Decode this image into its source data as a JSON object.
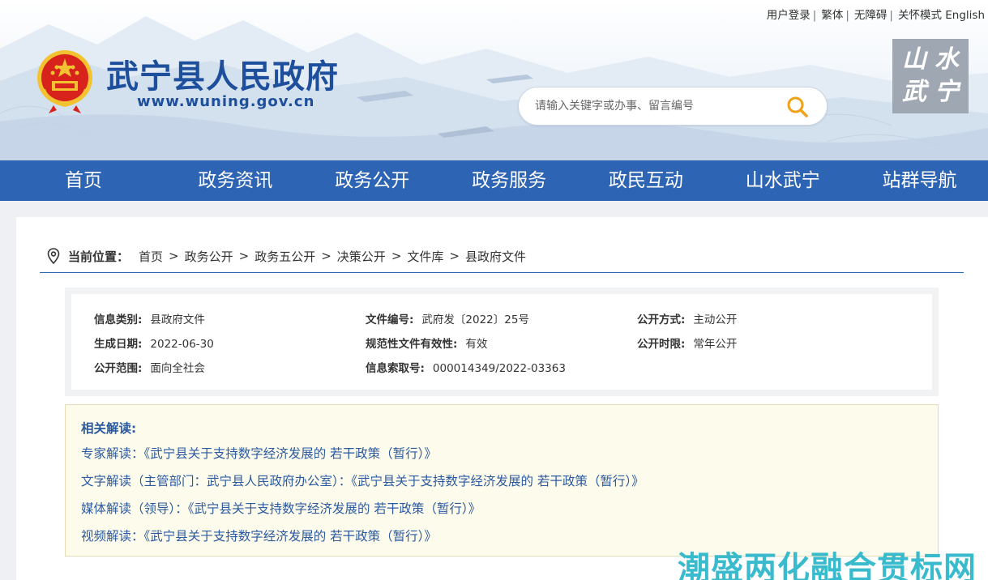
{
  "top_links": {
    "login": "用户登录",
    "traditional": "繁体",
    "accessibility": "无障碍",
    "care_mode": "关怀模式",
    "english": "English",
    "separator": "|"
  },
  "site": {
    "title": "武宁县人民政府",
    "url": "www.wuning.gov.cn",
    "seal_chars": [
      "山",
      "水",
      "武",
      "宁"
    ]
  },
  "search": {
    "placeholder": "请输入关键字或办事、留言编号",
    "value": ""
  },
  "nav": {
    "items": [
      "首页",
      "政务资讯",
      "政务公开",
      "政务服务",
      "政民互动",
      "山水武宁",
      "站群导航"
    ]
  },
  "breadcrumb": {
    "label": "当前位置：",
    "items": [
      "首页",
      "政务公开",
      "政务五公开",
      "决策公开",
      "文件库",
      "县政府文件"
    ],
    "arrow": ">"
  },
  "info": {
    "category": {
      "label": "信息类别:",
      "value": "县政府文件"
    },
    "doc_number": {
      "label": "文件编号:",
      "value": "武府发〔2022〕25号"
    },
    "disclosure_method": {
      "label": "公开方式:",
      "value": "主动公开"
    },
    "date": {
      "label": "生成日期:",
      "value": "2022-06-30"
    },
    "validity": {
      "label": "规范性文件有效性:",
      "value": "有效"
    },
    "disclosure_period": {
      "label": "公开时限:",
      "value": "常年公开"
    },
    "scope": {
      "label": "公开范围:",
      "value": "面向全社会"
    },
    "index_number": {
      "label": "信息索取号:",
      "value": "000014349/2022-03363"
    }
  },
  "related": {
    "heading": "相关解读:",
    "items": [
      "专家解读：《武宁县关于支持数字经济发展的 若干政策（暂行）》",
      "文字解读（主管部门：武宁县人民政府办公室）：《武宁县关于支持数字经济发展的 若干政策（暂行）》",
      "媒体解读（领导）：《武宁县关于支持数字经济发展的 若干政策（暂行）》",
      "视频解读：《武宁县关于支持数字经济发展的 若干政策（暂行）》"
    ]
  },
  "watermark": "潮盛两化融合贯标网",
  "colors": {
    "brand_blue": "#2e64b4",
    "title_blue": "#1d4f9c",
    "link_blue": "#2c5aa0",
    "related_bg": "#fdfbeb",
    "emblem_red": "#d8231c",
    "emblem_gold": "#f2c230",
    "watermark": "#2ab6c9"
  }
}
